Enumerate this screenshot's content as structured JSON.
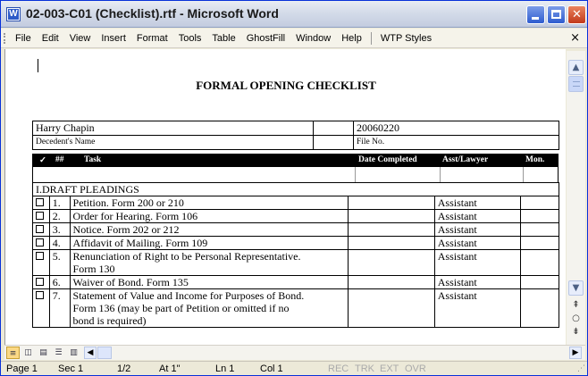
{
  "window": {
    "title": "02-003-C01 (Checklist).rtf - Microsoft Word",
    "app_icon": "word-document-icon",
    "controls": {
      "minimize": "minimize-icon",
      "maximize": "maximize-icon",
      "close": "close-icon"
    }
  },
  "menu": {
    "items": [
      "File",
      "Edit",
      "View",
      "Insert",
      "Format",
      "Tools",
      "Table",
      "GhostFill",
      "Window",
      "Help"
    ],
    "extra": "WTP Styles",
    "close_glyph": "×"
  },
  "document": {
    "title": "FORMAL OPENING CHECKLIST",
    "decedent_name": "Harry Chapin",
    "decedent_label": "Decedent's Name",
    "file_no": "20060220",
    "file_no_label": "File No.",
    "columns": {
      "check": "✓",
      "num": "##",
      "task": "Task",
      "date": "Date Completed",
      "asst": "Asst/Lawyer",
      "mon": "Mon."
    },
    "section": "I.DRAFT PLEADINGS",
    "tasks": [
      {
        "num": "1.",
        "task": "Petition.  Form 200 or 210",
        "asst": "Assistant"
      },
      {
        "num": "2.",
        "task": "Order for Hearing.  Form 106",
        "asst": "Assistant"
      },
      {
        "num": "3.",
        "task": "Notice.  Form 202 or 212",
        "asst": "Assistant"
      },
      {
        "num": "4.",
        "task": "Affidavit of Mailing.  Form 109",
        "asst": "Assistant"
      },
      {
        "num": "5.",
        "task_lines": [
          "Renunciation of Right to be Personal Representative.",
          "Form 130"
        ],
        "asst": "Assistant"
      },
      {
        "num": "6.",
        "task": "Waiver of Bond.  Form 135",
        "asst": "Assistant"
      },
      {
        "num": "7.",
        "task_lines": [
          "Statement of Value and Income for Purposes of Bond.",
          "Form 136 (may be part of Petition or omitted if no",
          "bond is required)"
        ],
        "asst": "Assistant"
      }
    ]
  },
  "statusbar": {
    "page": "Page  1",
    "sec": "Sec  1",
    "pages": "1/2",
    "at": "At  1\"",
    "ln": "Ln  1",
    "col": "Col  1",
    "rec": "REC",
    "trk": "TRK",
    "ext": "EXT",
    "ovr": "OVR"
  },
  "colors": {
    "title_bar": "#d4dbe9",
    "close_button": "#c2391b",
    "view_active": "#fbd986"
  }
}
